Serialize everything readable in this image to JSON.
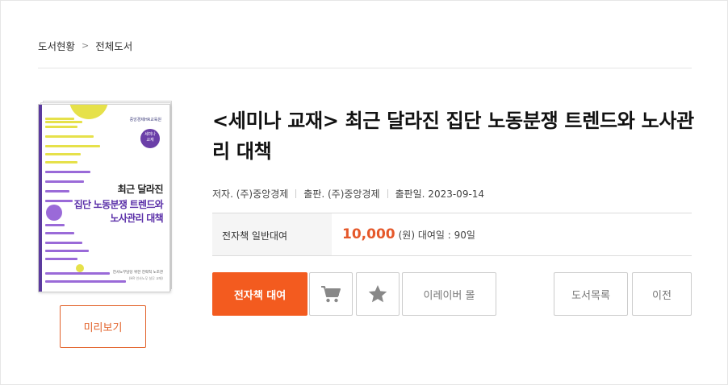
{
  "breadcrumb": {
    "home": "도서현황",
    "separator": ">",
    "current": "전체도서"
  },
  "cover": {
    "publisher_mark": "중앙경제HR교육원",
    "badge_line1": "세미나",
    "badge_line2": "교재",
    "title_line1": "최근 달라진",
    "title_line2": "집단 노동분쟁 트렌드와",
    "title_line3": "노사관리 대책",
    "footer_line1": "전사노무담당 위한 전략적 노조관",
    "footer_line2": "(HR 인사노무 실무 교재)",
    "colors": {
      "spine": "#5b3a9e",
      "accent_yellow": "#e6e14a",
      "accent_purple": "#9a6ad8"
    }
  },
  "preview_button": "미리보기",
  "book": {
    "title": "<세미나 교재> 최근 달라진 집단 노동분쟁 트렌드와 노사관리 대책",
    "author": "저자. (주)중앙경제",
    "publisher": "출판. (주)중앙경제",
    "pub_date": "출판일. 2023-09-14"
  },
  "price": {
    "label": "전자책 일반대여",
    "amount": "10,000",
    "unit": "(원)",
    "period": "대여일 : 90일"
  },
  "actions": {
    "rent": "전자책 대여",
    "cart_icon": "cart-icon",
    "favorite_icon": "star-icon",
    "mall": "이레이버 몰",
    "list": "도서목록",
    "prev": "이전"
  },
  "theme": {
    "accent": "#f35b1f",
    "price_color": "#e5582a"
  }
}
